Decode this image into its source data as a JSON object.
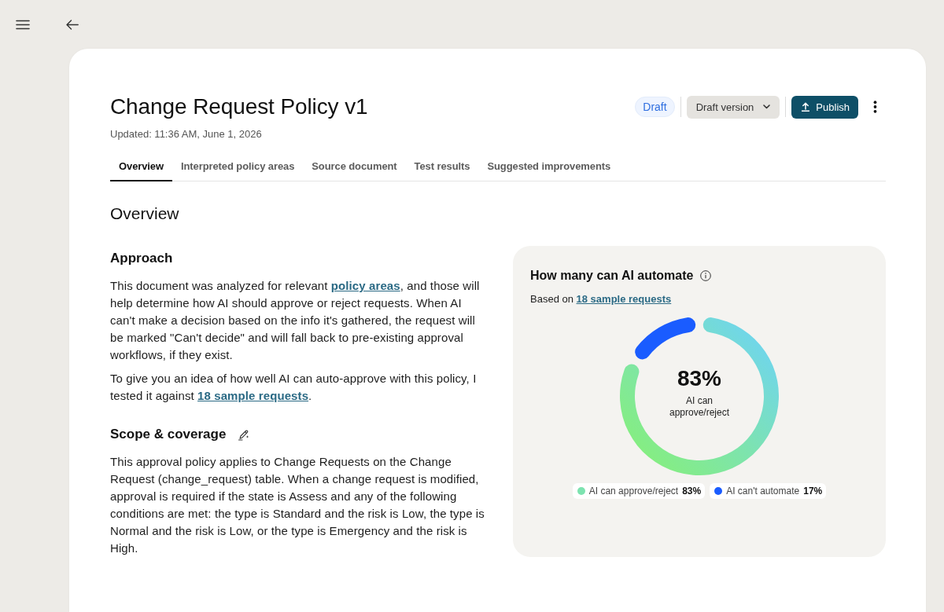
{
  "header": {
    "title": "Change Request Policy v1",
    "updated": "Updated: 11:36 AM, June 1, 2026",
    "status": "Draft",
    "version_dropdown": {
      "value": "Draft version"
    },
    "publish_button": {
      "label": "Publish"
    }
  },
  "tabs": [
    {
      "label": "Overview",
      "selected": true
    },
    {
      "label": "Interpreted policy areas",
      "selected": false
    },
    {
      "label": "Source document",
      "selected": false
    },
    {
      "label": "Test results",
      "selected": false
    },
    {
      "label": "Suggested improvements",
      "selected": false
    }
  ],
  "overview": {
    "heading": "Overview",
    "sections": [
      {
        "heading": "Approach",
        "editable": false,
        "paragraphs": [
          [
            {
              "kind": "text",
              "text": "This document was analyzed for relevant "
            },
            {
              "kind": "link",
              "text": "policy areas"
            },
            {
              "kind": "text",
              "text": ", and those will help determine how AI should approve or reject requests. When AI can't make a decision based on the info it's gathered, the request will be marked \"Can't decide\" and will fall back to pre-existing approval workflows, if they exist."
            }
          ],
          [
            {
              "kind": "text",
              "text": "To give you an idea of how well AI can auto-approve with this policy, I tested it against "
            },
            {
              "kind": "link",
              "text": "18 sample requests"
            },
            {
              "kind": "text",
              "text": "."
            }
          ]
        ]
      },
      {
        "heading": "Scope & coverage",
        "editable": true,
        "paragraphs": [
          [
            {
              "kind": "text",
              "text": "This approval policy applies to Change Requests on the Change Request (change_request) table. When a change request is modified, approval is required if the state is Assess and any of the following conditions are met: the type is Standard and the risk is Low, the type is Normal and the risk is Low, or the type is Emergency and the risk is High."
            }
          ]
        ]
      }
    ]
  },
  "automation_card": {
    "title": "How many can AI automate",
    "subtitle": [
      {
        "kind": "text",
        "text": "Based on "
      },
      {
        "kind": "link",
        "text": "18 sample requests"
      }
    ],
    "center_value": "83%",
    "center_label": "AI can approve/reject",
    "legend": [
      {
        "value": "83%",
        "color": "#7de3b0"
      },
      {
        "value": "17%",
        "color": "#1a5cff"
      }
    ],
    "chart_data": {
      "type": "donut",
      "categories": [
        "AI can approve/reject",
        "AI can't automate"
      ],
      "values": [
        83,
        17
      ]
    }
  }
}
